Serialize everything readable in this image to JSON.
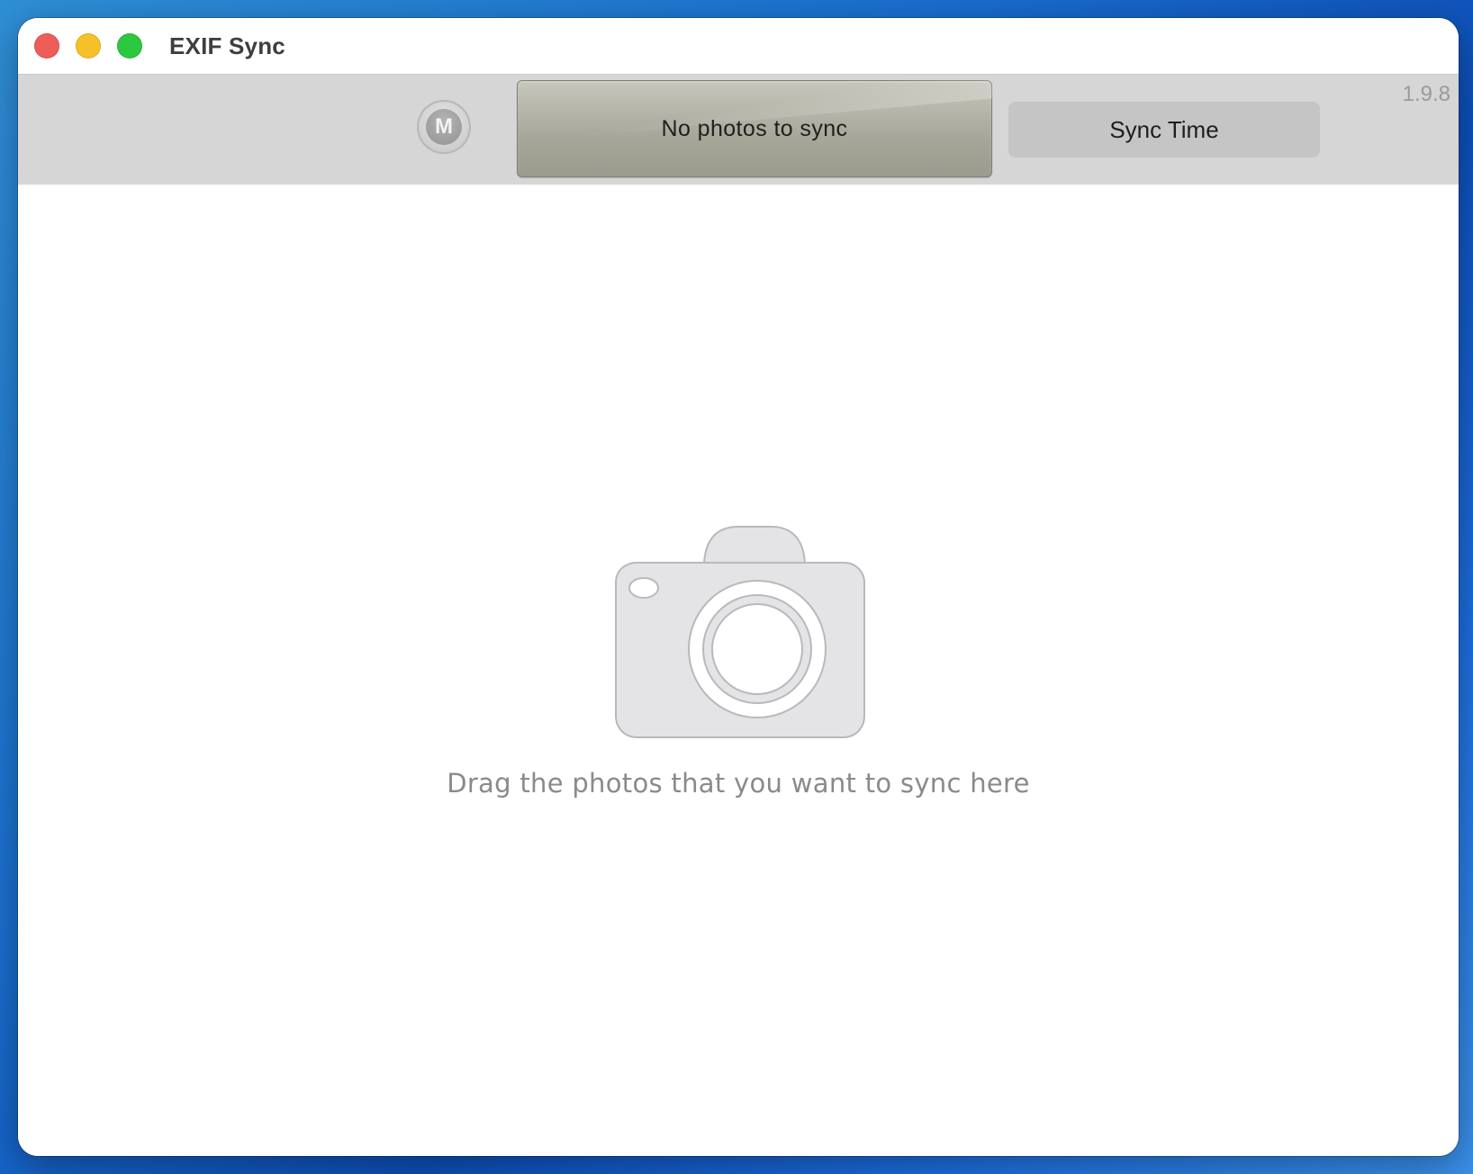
{
  "window": {
    "title": "EXIF Sync"
  },
  "toolbar": {
    "m_button_label": "M",
    "status_text": "No photos to sync",
    "sync_button_label": "Sync Time",
    "version": "1.9.8"
  },
  "drop_area": {
    "hint": "Drag the photos that you want to sync here",
    "icon": "camera-icon"
  },
  "colors": {
    "close": "#ee5d59",
    "minimize": "#f6c029",
    "zoom": "#2cc83f",
    "toolbar_bg": "#d6d6d6",
    "hint_text": "#8a8a8e"
  }
}
